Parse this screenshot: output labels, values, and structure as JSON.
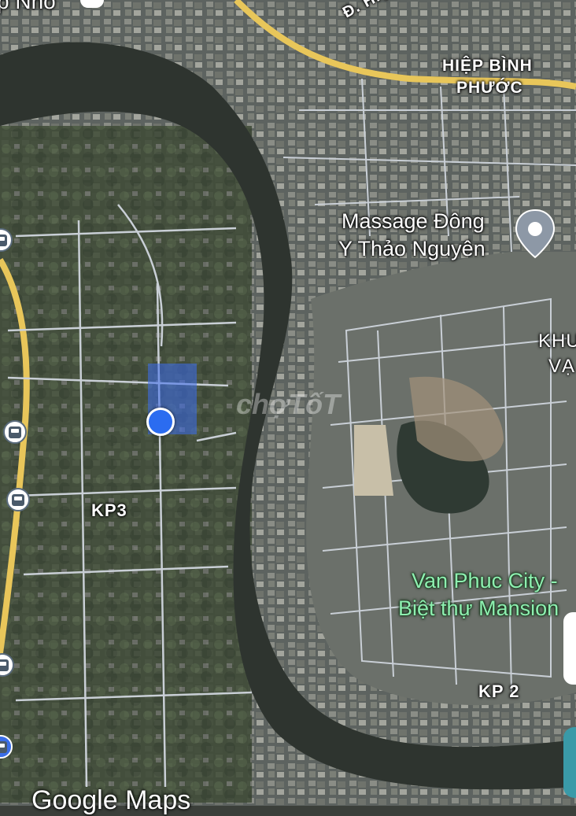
{
  "labels": {
    "top_left_cut": "p Nhỏ",
    "street": "Đ. Hiệp",
    "district_line1": "HIỆP BÌNH",
    "district_line2": "PHƯỚC",
    "poi_line1": "Massage Đông",
    "poi_line2": "Y Thảo Nguyên",
    "khu_line1": "KHU",
    "khu_line2": "VẠ",
    "kp3": "KP3",
    "vanphuc_line1": "Van Phuc City -",
    "vanphuc_line2": "Biệt thự Mansion",
    "kp2": "KP 2",
    "watermark": "chợTốT",
    "google": "Google Maps"
  },
  "icons": [
    "location-pin-icon",
    "bus-stop-icon",
    "current-location-dot"
  ],
  "colors": {
    "river": "#2e342f",
    "land": "#4a5047",
    "road": "#c9cfd6",
    "highway": "#e8c65a",
    "poi_green": "#8ef0b0",
    "dot": "#2b6cf0"
  }
}
